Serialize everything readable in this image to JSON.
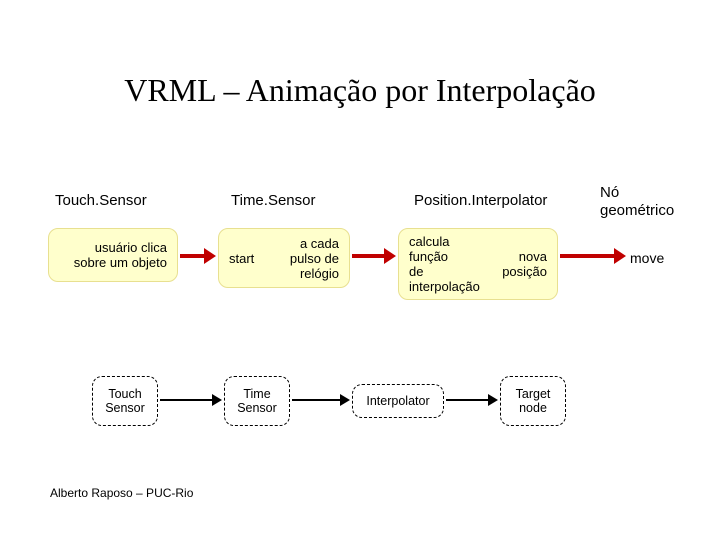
{
  "title": "VRML – Animação por Interpolação",
  "columns": {
    "c1": "Touch.Sensor",
    "c2": "Time.Sensor",
    "c3": "Position.Interpolator",
    "c4": "Nó\ngeométrico"
  },
  "boxes": {
    "b1": {
      "left": "",
      "right": "usuário clica\nsobre um objeto"
    },
    "b2": {
      "left": "start",
      "right": "a cada\npulso de\nrelógio"
    },
    "b3": {
      "left": "calcula\nfunção\nde\ninterpolação",
      "right": "nova\nposição"
    }
  },
  "move_label": "move",
  "diagram2": {
    "d1": "Touch\nSensor",
    "d2": "Time\nSensor",
    "d3": "Interpolator",
    "d4": "Target\nnode"
  },
  "footer": "Alberto Raposo – PUC-Rio"
}
